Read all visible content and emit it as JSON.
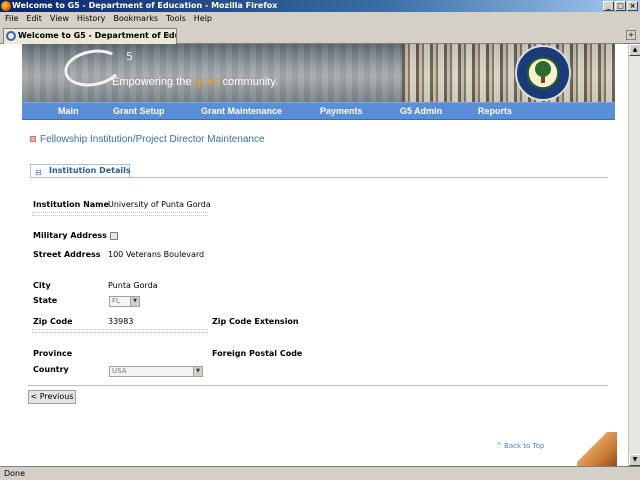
{
  "window": {
    "title": "Welcome to G5 - Department of Education - Mozilla Firefox"
  },
  "menubar": {
    "items": [
      "File",
      "Edit",
      "View",
      "History",
      "Bookmarks",
      "Tools",
      "Help"
    ]
  },
  "browser_tab": {
    "label": "Welcome to G5 - Department of Edu..."
  },
  "banner": {
    "logo_sup": "5",
    "tagline_pre": "Empowering the ",
    "tagline_highlight": "grant",
    "tagline_post": " community."
  },
  "nav": {
    "items": [
      "Main",
      "Grant Setup",
      "Grant Maintenance",
      "Payments",
      "G5 Admin",
      "Reports"
    ]
  },
  "page": {
    "heading": "Fellowship Institution/Project Director Maintenance",
    "section_tab": "Institution Details"
  },
  "form": {
    "institution_name_label": "Institution Name",
    "institution_name": "University of Punta Gorda",
    "military_address_label": "Military Address",
    "street_address_label": "Street Address",
    "street_address": "100 Veterans Boulevard",
    "city_label": "City",
    "city": "Punta Gorda",
    "state_label": "State",
    "state": "FL",
    "zip_label": "Zip Code",
    "zip": "33983",
    "zip_ext_label": "Zip Code Extension",
    "province_label": "Province",
    "foreign_postal_label": "Foreign Postal Code",
    "country_label": "Country",
    "country": "USA"
  },
  "buttons": {
    "previous": "< Previous"
  },
  "footer": {
    "back_to_top": "^ Back to Top"
  },
  "statusbar": {
    "text": "Done"
  }
}
